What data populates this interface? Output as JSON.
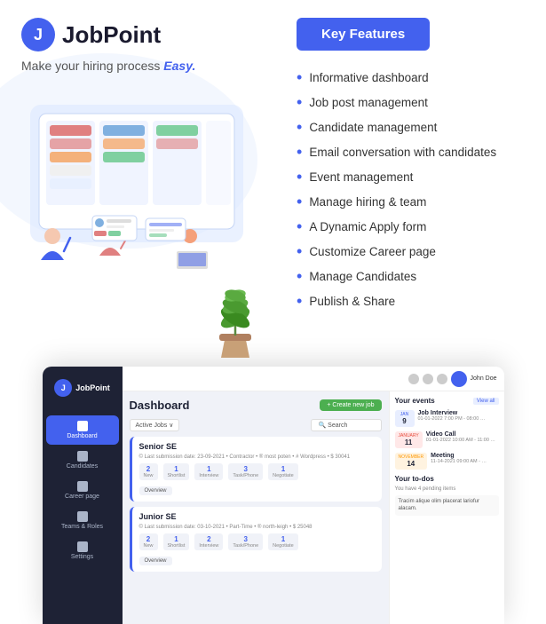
{
  "logo": {
    "icon": "J",
    "text": "JobPoint",
    "tagline": "Make your hiring process ",
    "tagline_em": "Easy."
  },
  "key_features": {
    "button_label": "Key Features",
    "items": [
      {
        "text": "Informative dashboard"
      },
      {
        "text": "Job post management"
      },
      {
        "text": "Candidate management"
      },
      {
        "text": "Email conversation with candidates"
      },
      {
        "text": "Event management"
      },
      {
        "text": "Manage hiring & team"
      },
      {
        "text": "A Dynamic Apply form"
      },
      {
        "text": "Customize Career page"
      },
      {
        "text": "Manage Candidates"
      },
      {
        "text": "Publish & Share"
      }
    ]
  },
  "dashboard": {
    "title": "Dashboard",
    "create_btn": "+ Create new job",
    "filter_label": "Active Jobs ∨",
    "search_placeholder": "🔍 Search",
    "jobs": [
      {
        "title": "Senior SE",
        "meta": "© Last submission date: 23-09-2021  •  Contractor  •  ® most poten  •  # Wordpress  •  $ 30041",
        "stats": [
          {
            "num": "2",
            "label": "New"
          },
          {
            "num": "1",
            "label": "Shortlist"
          },
          {
            "num": "1",
            "label": "Interview"
          },
          {
            "num": "3",
            "label": "Task/Phone"
          },
          {
            "num": "1",
            "label": "Negotiate"
          }
        ],
        "btn": "Overview"
      },
      {
        "title": "Junior SE",
        "meta": "© Last submission date: 03-10-2021  •  Part-Time  •  ® north-leigh  •  $ 25048",
        "stats": [
          {
            "num": "2",
            "label": "New"
          },
          {
            "num": "1",
            "label": "Shortlist"
          },
          {
            "num": "2",
            "label": "Interview"
          },
          {
            "num": "3",
            "label": "Task/Phone"
          },
          {
            "num": "1",
            "label": "Negotiate"
          }
        ],
        "btn": "Overview"
      }
    ],
    "events": {
      "title": "Your events",
      "view_all": "View all",
      "items": [
        {
          "color": "blue",
          "month": "Jan",
          "day": "9",
          "name": "Job Interview",
          "time": "01-01-2022 7:00 PM - 08:00 …"
        },
        {
          "color": "red",
          "month": "January",
          "day": "11",
          "name": "Video Call",
          "time": "01-01-2022 10:00 AM - 11:00 …"
        },
        {
          "color": "orange",
          "month": "November",
          "day": "14",
          "name": "Meeting",
          "time": "11-14-2021 09:00 AM - …"
        }
      ]
    },
    "todos": {
      "title": "Your to-dos",
      "info": "You have 4 pending items",
      "text": "Tracim alique olim placerat lariofur alacam."
    },
    "sidebar": {
      "logo": "J",
      "logo_text": "JobPoint",
      "nav": [
        {
          "label": "Dashboard",
          "active": true
        },
        {
          "label": "Candidates",
          "active": false
        },
        {
          "label": "Career page",
          "active": false
        },
        {
          "label": "Teams & Roles",
          "active": false
        },
        {
          "label": "Settings",
          "active": false
        }
      ]
    }
  }
}
